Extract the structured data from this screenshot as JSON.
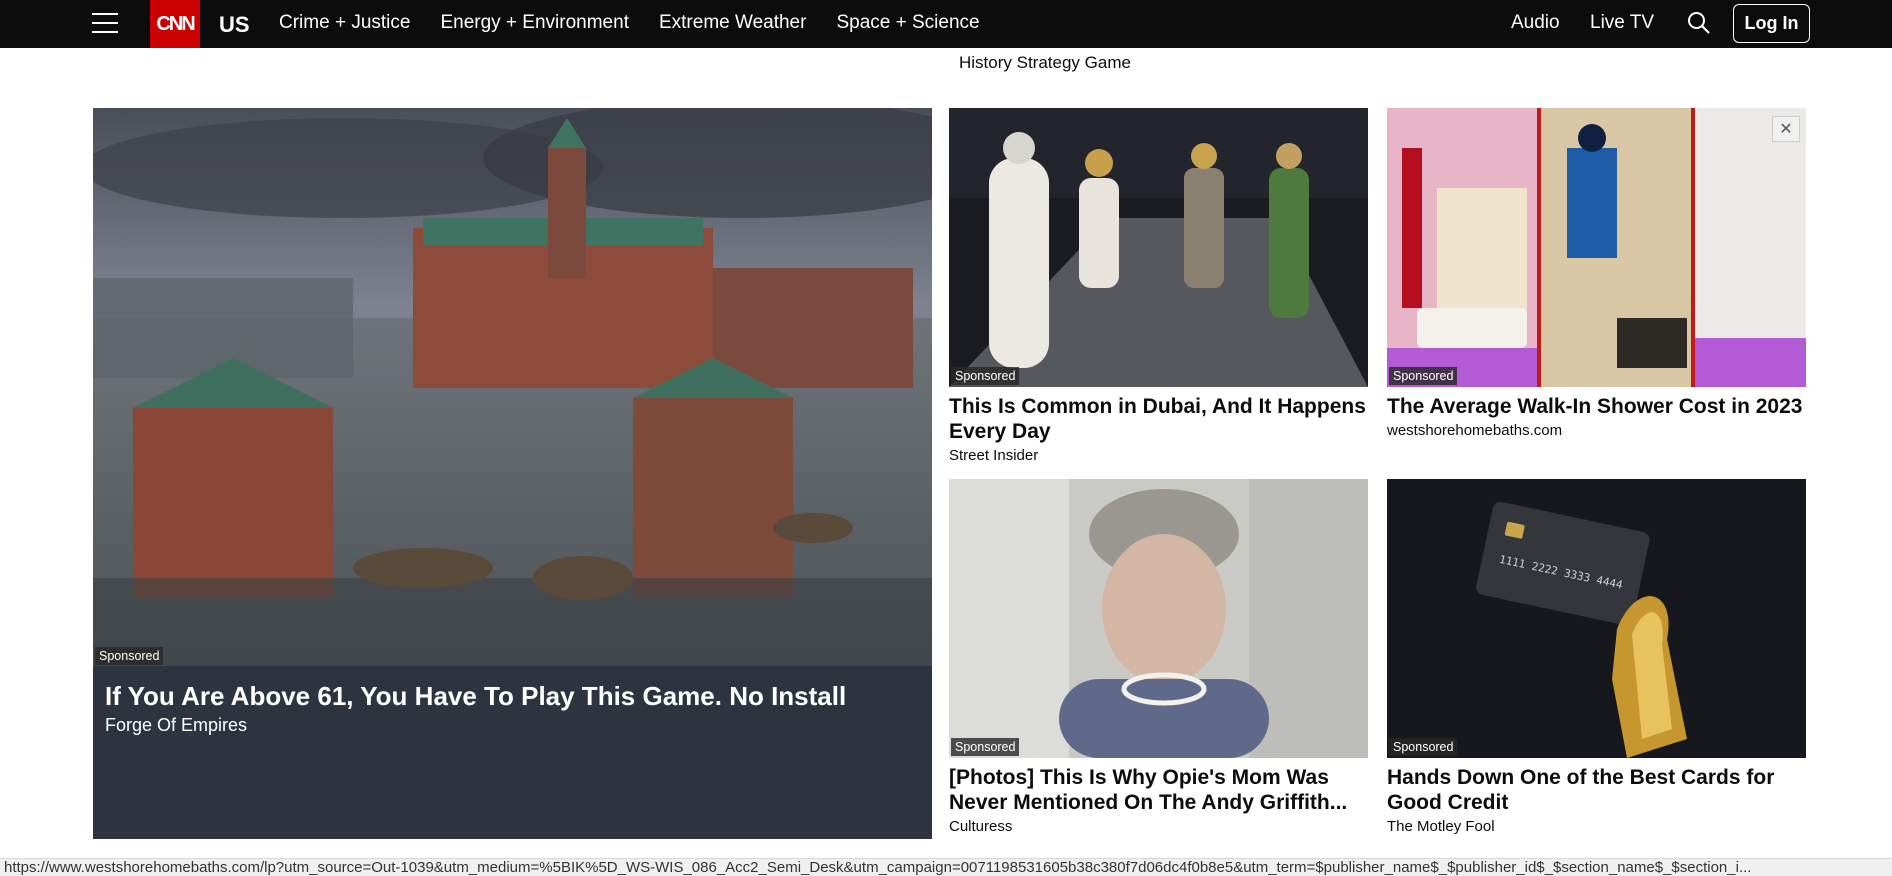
{
  "nav": {
    "logo": "CNN",
    "edition": "US",
    "links": [
      "Crime + Justice",
      "Energy + Environment",
      "Extreme Weather",
      "Space + Science"
    ],
    "audio": "Audio",
    "live_tv": "Live TV",
    "login": "Log In",
    "icons": {
      "menu": "hamburger-icon",
      "search": "search-icon"
    },
    "colors": {
      "bar": "#0c0c0c",
      "logo_bg": "#cc0000"
    }
  },
  "prev_caption": "History Strategy Game",
  "ads": {
    "sponsored_label": "Sponsored",
    "big": {
      "title": "If You Are Above 61, You Have To Play This Game. No Install",
      "source": "Forge Of Empires"
    },
    "items": [
      {
        "title": "This Is Common in Dubai, And It Happens Every Day",
        "source": "Street Insider"
      },
      {
        "title": "The Average Walk-In Shower Cost in 2023",
        "source": "westshorehomebaths.com"
      },
      {
        "title": "[Photos] This Is Why Opie's Mom Was Never Mentioned On The Andy Griffith...",
        "source": "Culturess"
      },
      {
        "title": "Hands Down One of the Best Cards for Good Credit",
        "source": "The Motley Fool"
      }
    ],
    "close_icon": "close-icon"
  },
  "status_url": "https://www.westshorehomebaths.com/lp?utm_source=Out-1039&utm_medium=%5BIK%5D_WS-WIS_086_Acc2_Semi_Desk&utm_campaign=0071198531605b38c380f7d06dc4f0b8e5&utm_term=$publisher_name$_$publisher_id$_$section_name$_$section_i..."
}
